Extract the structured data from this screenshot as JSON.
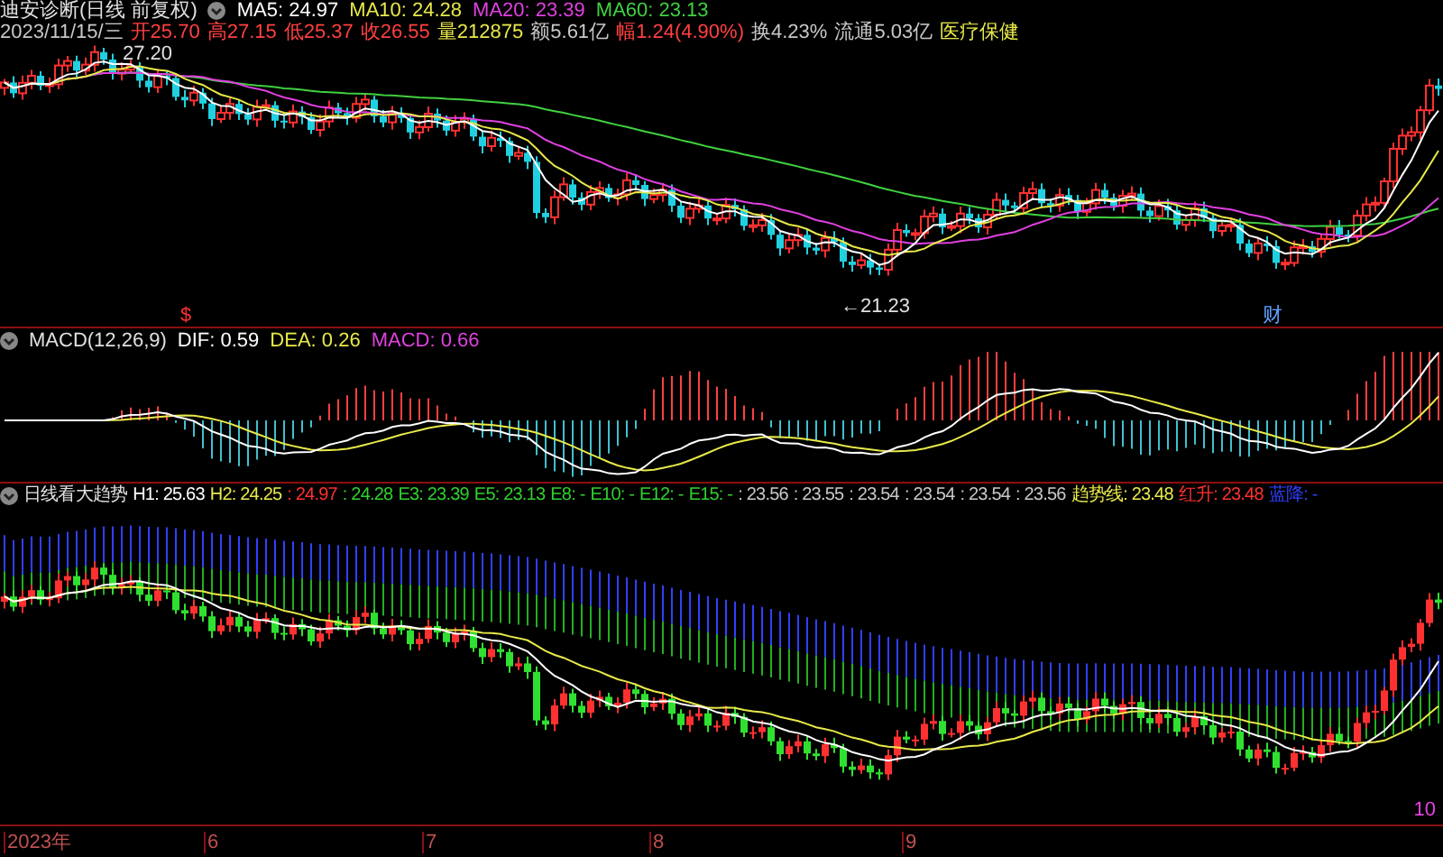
{
  "main": {
    "title": "迪安诊断(日线 前复权)",
    "ma": [
      {
        "label": "MA5: 24.97",
        "color": "#ffffff"
      },
      {
        "label": "MA10: 24.28",
        "color": "#e8e84a"
      },
      {
        "label": "MA20: 23.39",
        "color": "#e040e0"
      },
      {
        "label": "MA60: 23.13",
        "color": "#40d040"
      }
    ],
    "quote": [
      {
        "text": "2023/11/15/三",
        "color": "#c8c8c8"
      },
      {
        "text": "开25.70",
        "color": "#ff4040"
      },
      {
        "text": "高27.15",
        "color": "#ff4040"
      },
      {
        "text": "低25.37",
        "color": "#ff4040"
      },
      {
        "text": "收26.55",
        "color": "#ff4040"
      },
      {
        "text": "量212875",
        "color": "#e8e84a"
      },
      {
        "text": "额5.61亿",
        "color": "#c8c8c8"
      },
      {
        "text": "幅1.24(4.90%)",
        "color": "#ff4040"
      },
      {
        "text": "换4.23%",
        "color": "#c8c8c8"
      },
      {
        "text": "流通5.03亿",
        "color": "#c8c8c8"
      },
      {
        "text": "医疗保健",
        "color": "#e8e84a"
      }
    ],
    "high_label": "27.20",
    "low_label": "←21.23",
    "markers": [
      {
        "text": "$",
        "color": "#ff3030"
      },
      {
        "text": "财",
        "color": "#60a0ff"
      }
    ]
  },
  "macd": {
    "title": "MACD(12,26,9)",
    "values": [
      {
        "label": "DIF: 0.59",
        "color": "#ffffff"
      },
      {
        "label": "DEA: 0.26",
        "color": "#e8e84a"
      },
      {
        "label": "MACD: 0.66",
        "color": "#e040e0"
      }
    ]
  },
  "trend": {
    "title": "日线看大趋势",
    "values": [
      {
        "label": "H1: 25.63",
        "color": "#ffffff"
      },
      {
        "label": "H2: 24.25",
        "color": "#e8e84a"
      },
      {
        "label": ": 24.97",
        "color": "#ff3030"
      },
      {
        "label": ": 24.28",
        "color": "#30d030"
      },
      {
        "label": "E3: 23.39",
        "color": "#30d030"
      },
      {
        "label": "E5: 23.13",
        "color": "#30d030"
      },
      {
        "label": "E8: -",
        "color": "#30d030"
      },
      {
        "label": "E10: -",
        "color": "#30d030"
      },
      {
        "label": "E12: -",
        "color": "#30d030"
      },
      {
        "label": "E15: -",
        "color": "#30d030"
      },
      {
        "label": ": 23.56",
        "color": "#c8c8c8"
      },
      {
        "label": ": 23.55",
        "color": "#c8c8c8"
      },
      {
        "label": ": 23.54",
        "color": "#c8c8c8"
      },
      {
        "label": ": 23.54",
        "color": "#c8c8c8"
      },
      {
        "label": ": 23.54",
        "color": "#c8c8c8"
      },
      {
        "label": ": 23.56",
        "color": "#c8c8c8"
      },
      {
        "label": "趋势线: 23.48",
        "color": "#e8e84a"
      },
      {
        "label": "红升: 23.48",
        "color": "#ff3030"
      },
      {
        "label": "蓝降: -",
        "color": "#3040ff"
      }
    ],
    "corner_label": "10"
  },
  "axis": [
    "2023年",
    "6",
    "7",
    "8",
    "9"
  ]
}
